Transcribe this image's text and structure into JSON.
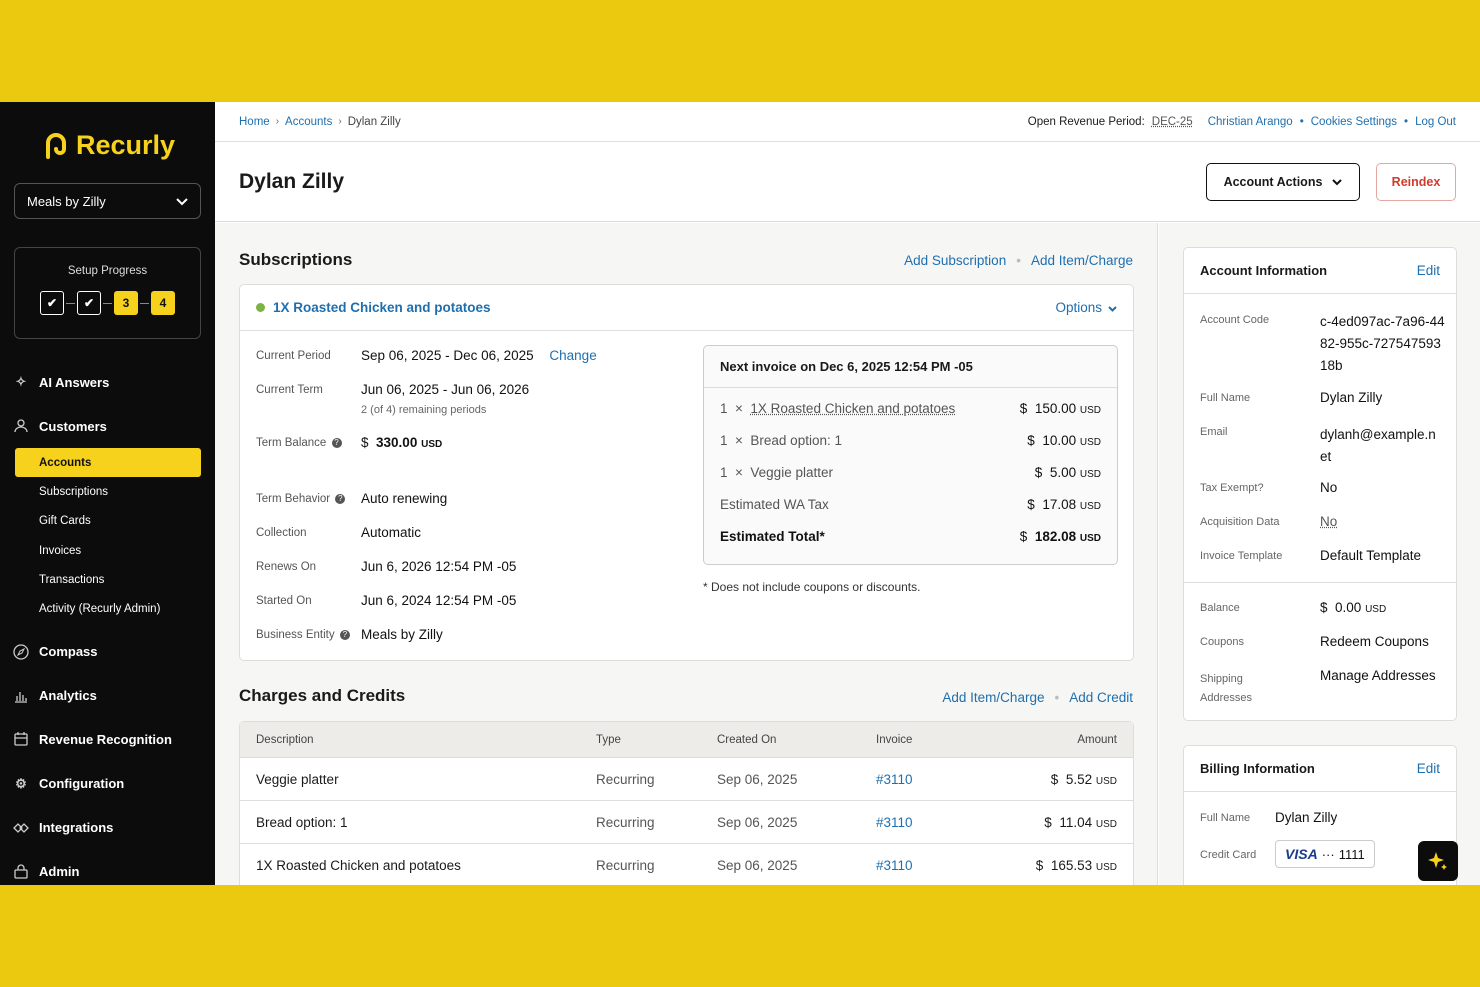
{
  "sidebar": {
    "brand": "Recurly",
    "site": "Meals by Zilly",
    "setup": {
      "label": "Setup Progress",
      "step3": "3",
      "step4": "4"
    },
    "nav": {
      "ai": "AI Answers",
      "customers": "Customers",
      "accounts": "Accounts",
      "subscriptions": "Subscriptions",
      "gift_cards": "Gift Cards",
      "invoices": "Invoices",
      "transactions": "Transactions",
      "activity": "Activity (Recurly Admin)",
      "compass": "Compass",
      "analytics": "Analytics",
      "revenue": "Revenue Recognition",
      "configuration": "Configuration",
      "integrations": "Integrations",
      "admin": "Admin"
    }
  },
  "topbar": {
    "crumb_home": "Home",
    "crumb_accounts": "Accounts",
    "crumb_current": "Dylan Zilly",
    "period_label": "Open Revenue Period:",
    "period_value": "DEC-25",
    "user": "Christian Arango",
    "cookies": "Cookies Settings",
    "logout": "Log Out"
  },
  "header": {
    "title": "Dylan Zilly",
    "actions": "Account Actions",
    "reindex": "Reindex"
  },
  "subscriptions": {
    "title": "Subscriptions",
    "add_sub": "Add Subscription",
    "add_item": "Add Item/Charge",
    "plan": "1X Roasted Chicken and potatoes",
    "options": "Options",
    "current_period_label": "Current Period",
    "current_period": "Sep 06, 2025 - Dec 06, 2025",
    "change": "Change",
    "current_term_label": "Current Term",
    "current_term": "Jun 06, 2025 - Jun 06, 2026",
    "remaining": "2 (of 4) remaining periods",
    "term_balance_label": "Term Balance",
    "term_balance": "330.00",
    "term_behavior_label": "Term Behavior",
    "term_behavior": "Auto renewing",
    "collection_label": "Collection",
    "collection": "Automatic",
    "renews_label": "Renews On",
    "renews": "Jun 6, 2026 12:54 PM -05",
    "started_label": "Started On",
    "started": "Jun 6, 2024 12:54 PM -05",
    "entity_label": "Business Entity",
    "entity": "Meals by Zilly",
    "invoice": {
      "heading": "Next invoice on Dec 6, 2025 12:54 PM -05",
      "rows": [
        {
          "qty": "1",
          "name": "1X Roasted Chicken and potatoes",
          "amount": "150.00"
        },
        {
          "qty": "1",
          "name": "Bread option: 1",
          "amount": "10.00"
        },
        {
          "qty": "1",
          "name": "Veggie platter",
          "amount": "5.00"
        }
      ],
      "tax_label": "Estimated WA Tax",
      "tax": "17.08",
      "total_label": "Estimated Total*",
      "total": "182.08"
    },
    "footnote": "* Does not include coupons or discounts."
  },
  "currency": {
    "symbol": "$",
    "code": "USD"
  },
  "charges": {
    "title": "Charges and Credits",
    "add_item": "Add Item/Charge",
    "add_credit": "Add Credit",
    "columns": [
      "Description",
      "Type",
      "Created On",
      "Invoice",
      "Amount"
    ],
    "rows": [
      {
        "desc": "Veggie platter",
        "type": "Recurring",
        "created": "Sep 06, 2025",
        "invoice": "#3110",
        "amount": "5.52"
      },
      {
        "desc": "Bread option: 1",
        "type": "Recurring",
        "created": "Sep 06, 2025",
        "invoice": "#3110",
        "amount": "11.04"
      },
      {
        "desc": "1X Roasted Chicken and potatoes",
        "type": "Recurring",
        "created": "Sep 06, 2025",
        "invoice": "#3110",
        "amount": "165.53"
      }
    ]
  },
  "account_info": {
    "title": "Account Information",
    "edit": "Edit",
    "code_label": "Account Code",
    "code": "c-4ed097ac-7a96-4482-955c-72754759318b",
    "name_label": "Full Name",
    "name": "Dylan Zilly",
    "email_label": "Email",
    "email": "dylanh@example.net",
    "tax_label": "Tax Exempt?",
    "tax": "No",
    "acq_label": "Acquisition Data",
    "acq": "No",
    "template_label": "Invoice Template",
    "template": "Default Template",
    "balance_label": "Balance",
    "balance": "0.00",
    "coupons_label": "Coupons",
    "coupons": "Redeem Coupons",
    "shipping_label": "Shipping Addresses",
    "shipping": "Manage Addresses"
  },
  "billing": {
    "title": "Billing Information",
    "edit": "Edit",
    "name_label": "Full Name",
    "name": "Dylan Zilly",
    "card_label": "Credit Card",
    "card_brand": "VISA",
    "card_last4": "1111"
  },
  "colors": {
    "brand_yellow": "#F6D21C",
    "link_blue": "#1f6fae",
    "reindex_red": "#d23a2a"
  }
}
